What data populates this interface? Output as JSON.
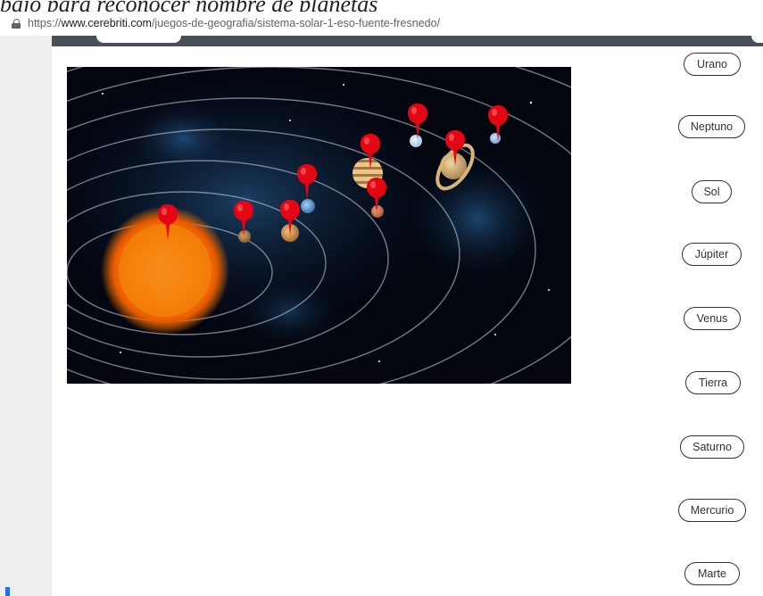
{
  "caption": "bajo para reconocer nombre de planetas",
  "browser": {
    "url_scheme": "https://",
    "url_host": "www.cerebriti.com",
    "url_path": "/juegos-de-geografia/sistema-solar-1-eso-fuente-fresnedo/"
  },
  "icons": {
    "lock": "lock-icon",
    "marker": "map-pin-icon"
  },
  "colors": {
    "marker": "#e30613",
    "topbar": "#4a5058",
    "rail": "#eeeeee",
    "accent": "#1a73e8"
  },
  "game": {
    "answers": [
      "Urano",
      "Neptuno",
      "Sol",
      "Júpiter",
      "Venus",
      "Tierra",
      "Saturno",
      "Mercurio",
      "Marte"
    ]
  }
}
